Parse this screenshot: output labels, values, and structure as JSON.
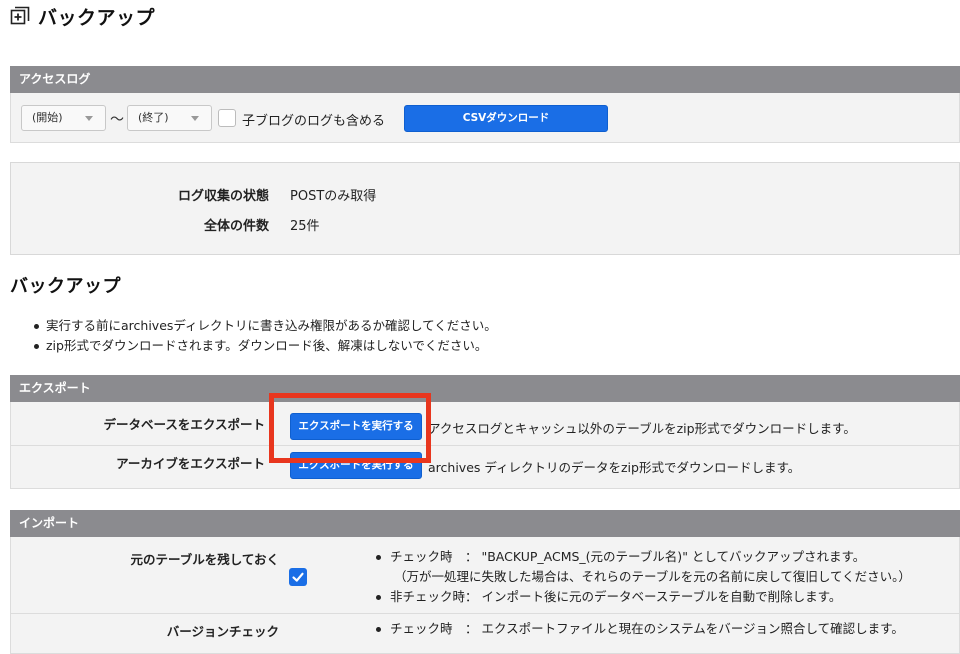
{
  "page": {
    "title": "バックアップ",
    "title_icon": "plus-square-icon"
  },
  "access_log": {
    "header": "アクセスログ",
    "start_select": "(開始)",
    "tilde": "〜",
    "end_select": "(終了)",
    "include_child_label": "子ブログのログも含める",
    "csv_button": "CSVダウンロード"
  },
  "log_info": {
    "status_label": "ログ収集の状態",
    "status_value": "POSTのみ取得",
    "count_label": "全体の件数",
    "count_value": "25件"
  },
  "backup": {
    "heading": "バックアップ",
    "notes": [
      "実行する前にarchivesディレクトリに書き込み権限があるか確認してください。",
      "zip形式でダウンロードされます。ダウンロード後、解凍はしないでください。"
    ]
  },
  "export": {
    "header": "エクスポート",
    "rows": [
      {
        "label": "データベースをエクスポート",
        "button": "エクスポートを実行する",
        "desc": "アクセスログとキャッシュ以外のテーブルをzip形式でダウンロードします。"
      },
      {
        "label": "アーカイブをエクスポート",
        "button": "エクスポートを実行する",
        "desc": "archives ディレクトリのデータをzip形式でダウンロードします。"
      }
    ]
  },
  "import": {
    "header": "インポート",
    "keep_tables": {
      "label": "元のテーブルを残しておく",
      "checked": true,
      "checked_text": "チェック時　：  \"BACKUP_ACMS_(元のテーブル名)\" としてバックアップされます。",
      "checked_sub": "（万が一処理に失敗した場合は、それらのテーブルを元の名前に戻して復旧してください。）",
      "unchecked_text": "非チェック時：  インポート後に元のデータベーステーブルを自動で削除します。"
    },
    "version_check": {
      "label": "バージョンチェック",
      "checked_text": "チェック時　：  エクスポートファイルと現在のシステムをバージョン照合して確認します。"
    }
  },
  "colors": {
    "section_header": "#8b8b8f",
    "primary_button": "#1a6ee6",
    "highlight": "#e8361e",
    "panel_bg": "#f3f3f3"
  }
}
